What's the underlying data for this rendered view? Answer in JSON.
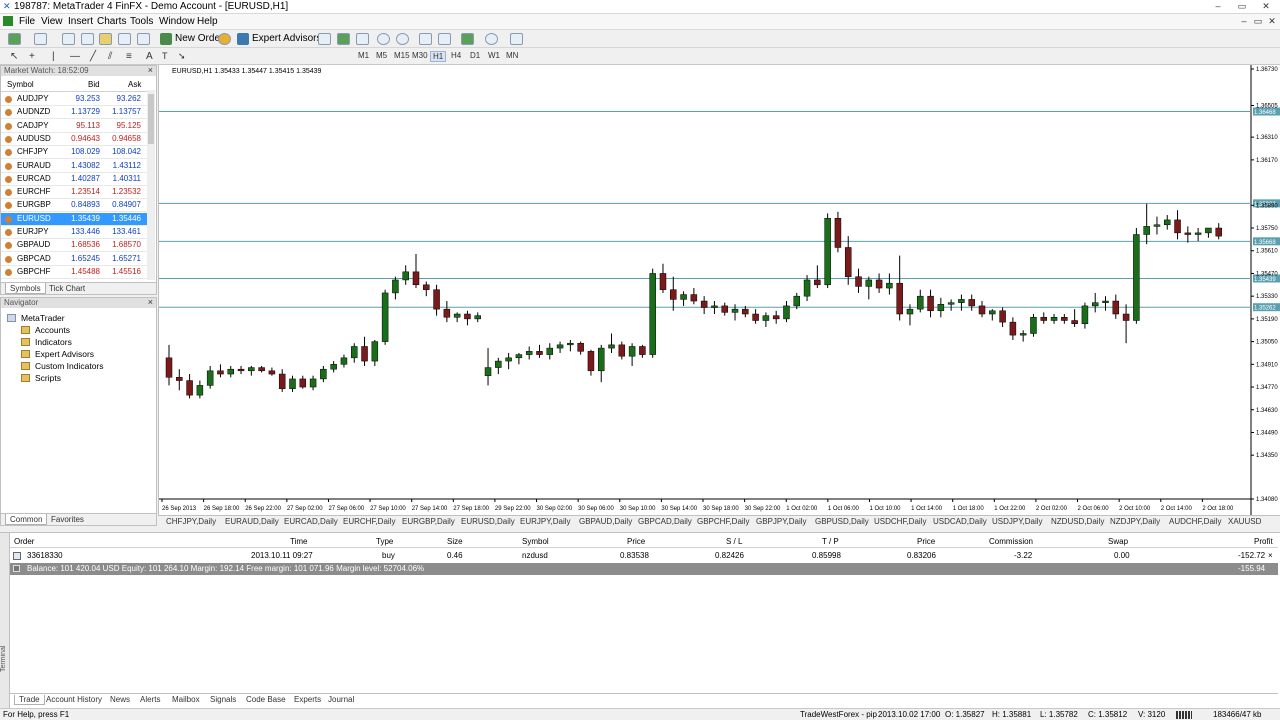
{
  "window": {
    "title": "198787: MetaTrader 4 FinFX - Demo Account - [EURUSD,H1]"
  },
  "menu": [
    "File",
    "View",
    "Insert",
    "Charts",
    "Tools",
    "Window",
    "Help"
  ],
  "toolbar": {
    "new_order": "New Order",
    "expert_advisors": "Expert Advisors",
    "timeframes": [
      "M1",
      "M5",
      "M15",
      "M30",
      "H1",
      "H4",
      "D1",
      "W1",
      "MN"
    ],
    "active_timeframe": "H1"
  },
  "market_watch": {
    "title": "Market Watch: 18:52:09",
    "headers": {
      "symbol": "Symbol",
      "bid": "Bid",
      "ask": "Ask"
    },
    "rows": [
      {
        "symbol": "AUDJPY",
        "bid": "93.253",
        "ask": "93.262",
        "dir": "up"
      },
      {
        "symbol": "AUDNZD",
        "bid": "1.13729",
        "ask": "1.13757",
        "dir": "up"
      },
      {
        "symbol": "CADJPY",
        "bid": "95.113",
        "ask": "95.125",
        "dir": "down"
      },
      {
        "symbol": "AUDUSD",
        "bid": "0.94643",
        "ask": "0.94658",
        "dir": "down"
      },
      {
        "symbol": "CHFJPY",
        "bid": "108.029",
        "ask": "108.042",
        "dir": "up"
      },
      {
        "symbol": "EURAUD",
        "bid": "1.43082",
        "ask": "1.43112",
        "dir": "up"
      },
      {
        "symbol": "EURCAD",
        "bid": "1.40287",
        "ask": "1.40311",
        "dir": "up"
      },
      {
        "symbol": "EURCHF",
        "bid": "1.23514",
        "ask": "1.23532",
        "dir": "down"
      },
      {
        "symbol": "EURGBP",
        "bid": "0.84893",
        "ask": "0.84907",
        "dir": "up"
      },
      {
        "symbol": "EURUSD",
        "bid": "1.35439",
        "ask": "1.35446",
        "dir": "sel"
      },
      {
        "symbol": "EURJPY",
        "bid": "133.446",
        "ask": "133.461",
        "dir": "up"
      },
      {
        "symbol": "GBPAUD",
        "bid": "1.68536",
        "ask": "1.68570",
        "dir": "down"
      },
      {
        "symbol": "GBPCAD",
        "bid": "1.65245",
        "ask": "1.65271",
        "dir": "up"
      },
      {
        "symbol": "GBPCHF",
        "bid": "1.45488",
        "ask": "1.45516",
        "dir": "down"
      }
    ],
    "tabs": [
      "Symbols",
      "Tick Chart"
    ]
  },
  "navigator": {
    "title": "Navigator",
    "root": "MetaTrader",
    "items": [
      "Accounts",
      "Indicators",
      "Expert Advisors",
      "Custom Indicators",
      "Scripts"
    ],
    "tabs": [
      "Common",
      "Favorites"
    ]
  },
  "chart": {
    "info": "EURUSD,H1  1.35433 1.35447 1.35415 1.35439",
    "price_labels": [
      "1.36730",
      "1.36505",
      "1.36310",
      "1.36170",
      "1.35890",
      "1.35750",
      "1.35610",
      "1.35470",
      "1.35330",
      "1.35190",
      "1.35050",
      "1.34910",
      "1.34770",
      "1.34630",
      "1.34490",
      "1.34350",
      "1.34080"
    ],
    "level_labels": [
      "1.36468",
      "1.35902",
      "1.35668",
      "1.35439",
      "1.35262"
    ],
    "time_labels": [
      "26 Sep 2013",
      "26 Sep 18:00",
      "26 Sep 22:00",
      "27 Sep 02:00",
      "27 Sep 06:00",
      "27 Sep 10:00",
      "27 Sep 14:00",
      "27 Sep 18:00",
      "29 Sep 22:00",
      "30 Sep 02:00",
      "30 Sep 06:00",
      "30 Sep 10:00",
      "30 Sep 14:00",
      "30 Sep 18:00",
      "30 Sep 22:00",
      "1 Oct 02:00",
      "1 Oct 06:00",
      "1 Oct 10:00",
      "1 Oct 14:00",
      "1 Oct 18:00",
      "1 Oct 22:00",
      "2 Oct 02:00",
      "2 Oct 06:00",
      "2 Oct 10:00",
      "2 Oct 14:00",
      "2 Oct 18:00"
    ],
    "tabs": [
      "CHFJPY,Daily",
      "EURAUD,Daily",
      "EURCAD,Daily",
      "EURCHF,Daily",
      "EURGBP,Daily",
      "EURUSD,Daily",
      "EURJPY,Daily",
      "GBPAUD,Daily",
      "GBPCAD,Daily",
      "GBPCHF,Daily",
      "GBPJPY,Daily",
      "GBPUSD,Daily",
      "USDCHF,Daily",
      "USDCAD,Daily",
      "USDJPY,Daily",
      "NZDUSD,Daily",
      "NZDJPY,Daily",
      "AUDCHF,Daily",
      "XAUUSD"
    ],
    "colors": {
      "bull": "#1a6e1a",
      "bear": "#7a1a1a",
      "level": "#5aa0b0"
    },
    "candles": [
      [
        1.3495,
        1.3503,
        1.3478,
        1.3483
      ],
      [
        1.3483,
        1.3488,
        1.3475,
        1.3481
      ],
      [
        1.3481,
        1.3485,
        1.347,
        1.3472
      ],
      [
        1.3472,
        1.3481,
        1.347,
        1.3478
      ],
      [
        1.3478,
        1.349,
        1.3476,
        1.3487
      ],
      [
        1.3487,
        1.3491,
        1.3483,
        1.3485
      ],
      [
        1.3485,
        1.349,
        1.3483,
        1.3488
      ],
      [
        1.3488,
        1.349,
        1.3485,
        1.3487
      ],
      [
        1.3487,
        1.349,
        1.3484,
        1.3489
      ],
      [
        1.3489,
        1.349,
        1.3486,
        1.3487
      ],
      [
        1.3487,
        1.3489,
        1.3484,
        1.3485
      ],
      [
        1.3485,
        1.3488,
        1.3474,
        1.3476
      ],
      [
        1.3476,
        1.3484,
        1.3474,
        1.3482
      ],
      [
        1.3482,
        1.3484,
        1.3476,
        1.3477
      ],
      [
        1.3477,
        1.3484,
        1.3475,
        1.3482
      ],
      [
        1.3482,
        1.349,
        1.348,
        1.3488
      ],
      [
        1.3488,
        1.3493,
        1.3486,
        1.3491
      ],
      [
        1.3491,
        1.3497,
        1.3489,
        1.3495
      ],
      [
        1.3495,
        1.3504,
        1.3492,
        1.3502
      ],
      [
        1.3502,
        1.3508,
        1.349,
        1.3493
      ],
      [
        1.3493,
        1.3506,
        1.349,
        1.3505
      ],
      [
        1.3505,
        1.3537,
        1.3503,
        1.3535
      ],
      [
        1.3535,
        1.3545,
        1.3531,
        1.3543
      ],
      [
        1.3543,
        1.3552,
        1.354,
        1.3548
      ],
      [
        1.3548,
        1.3559,
        1.3538,
        1.354
      ],
      [
        1.354,
        1.3542,
        1.3533,
        1.3537
      ],
      [
        1.3537,
        1.354,
        1.3521,
        1.3525
      ],
      [
        1.3525,
        1.353,
        1.3517,
        1.352
      ],
      [
        1.352,
        1.3523,
        1.3517,
        1.3522
      ],
      [
        1.3522,
        1.3524,
        1.3515,
        1.3519
      ],
      [
        1.3519,
        1.3523,
        1.3517,
        1.3521
      ],
      [
        1.3484,
        1.3501,
        1.3478,
        1.3489
      ],
      [
        1.3489,
        1.3495,
        1.3485,
        1.3493
      ],
      [
        1.3493,
        1.3498,
        1.3488,
        1.3495
      ],
      [
        1.3495,
        1.3498,
        1.3491,
        1.3497
      ],
      [
        1.3497,
        1.3502,
        1.3494,
        1.3499
      ],
      [
        1.3499,
        1.3503,
        1.3495,
        1.3497
      ],
      [
        1.3497,
        1.3504,
        1.3494,
        1.3501
      ],
      [
        1.3501,
        1.3505,
        1.3498,
        1.3503
      ],
      [
        1.3503,
        1.3506,
        1.3499,
        1.3504
      ],
      [
        1.3504,
        1.3505,
        1.3497,
        1.3499
      ],
      [
        1.3499,
        1.35,
        1.3484,
        1.3487
      ],
      [
        1.3487,
        1.3503,
        1.348,
        1.3501
      ],
      [
        1.3501,
        1.351,
        1.3498,
        1.3503
      ],
      [
        1.3503,
        1.3505,
        1.3494,
        1.3496
      ],
      [
        1.3496,
        1.3504,
        1.349,
        1.3502
      ],
      [
        1.3502,
        1.3503,
        1.3495,
        1.3497
      ],
      [
        1.3497,
        1.355,
        1.3495,
        1.3547
      ],
      [
        1.3547,
        1.3553,
        1.3535,
        1.3537
      ],
      [
        1.3537,
        1.3545,
        1.3524,
        1.3531
      ],
      [
        1.3531,
        1.3536,
        1.3527,
        1.3534
      ],
      [
        1.3534,
        1.3538,
        1.3528,
        1.353
      ],
      [
        1.353,
        1.3533,
        1.3522,
        1.3526
      ],
      [
        1.3526,
        1.353,
        1.3522,
        1.3527
      ],
      [
        1.3527,
        1.3529,
        1.3521,
        1.3523
      ],
      [
        1.3523,
        1.3528,
        1.3518,
        1.3525
      ],
      [
        1.3525,
        1.3527,
        1.352,
        1.3522
      ],
      [
        1.3522,
        1.3525,
        1.3516,
        1.3518
      ],
      [
        1.3518,
        1.3523,
        1.3514,
        1.3521
      ],
      [
        1.3521,
        1.3524,
        1.3516,
        1.3519
      ],
      [
        1.3519,
        1.353,
        1.3517,
        1.3527
      ],
      [
        1.3527,
        1.3535,
        1.3525,
        1.3533
      ],
      [
        1.3533,
        1.3546,
        1.353,
        1.3543
      ],
      [
        1.3543,
        1.3552,
        1.3538,
        1.354
      ],
      [
        1.354,
        1.3584,
        1.3538,
        1.3581
      ],
      [
        1.3581,
        1.3585,
        1.356,
        1.3563
      ],
      [
        1.3563,
        1.357,
        1.354,
        1.3545
      ],
      [
        1.3545,
        1.355,
        1.3535,
        1.3539
      ],
      [
        1.3539,
        1.3545,
        1.3531,
        1.3543
      ],
      [
        1.3543,
        1.3547,
        1.3535,
        1.3538
      ],
      [
        1.3538,
        1.3547,
        1.3534,
        1.3541
      ],
      [
        1.3541,
        1.3558,
        1.3518,
        1.3522
      ],
      [
        1.3522,
        1.3528,
        1.3515,
        1.3525
      ],
      [
        1.3525,
        1.3537,
        1.3523,
        1.3533
      ],
      [
        1.3533,
        1.3537,
        1.352,
        1.3524
      ],
      [
        1.3524,
        1.3532,
        1.352,
        1.3528
      ],
      [
        1.3528,
        1.3531,
        1.3524,
        1.3529
      ],
      [
        1.3529,
        1.3534,
        1.3524,
        1.3531
      ],
      [
        1.3531,
        1.3534,
        1.3524,
        1.3527
      ],
      [
        1.3527,
        1.353,
        1.352,
        1.3522
      ],
      [
        1.3522,
        1.3525,
        1.3518,
        1.3524
      ],
      [
        1.3524,
        1.3526,
        1.3514,
        1.3517
      ],
      [
        1.3517,
        1.352,
        1.3506,
        1.3509
      ],
      [
        1.3509,
        1.3512,
        1.3505,
        1.351
      ],
      [
        1.351,
        1.3522,
        1.3508,
        1.352
      ],
      [
        1.352,
        1.3523,
        1.3516,
        1.3518
      ],
      [
        1.3518,
        1.3522,
        1.3516,
        1.352
      ],
      [
        1.352,
        1.3522,
        1.3516,
        1.3518
      ],
      [
        1.3518,
        1.3525,
        1.3514,
        1.3516
      ],
      [
        1.3516,
        1.3529,
        1.3513,
        1.3527
      ],
      [
        1.3527,
        1.3535,
        1.3523,
        1.3529
      ],
      [
        1.3529,
        1.3533,
        1.3524,
        1.353
      ],
      [
        1.353,
        1.3534,
        1.3519,
        1.3522
      ],
      [
        1.3522,
        1.3528,
        1.3504,
        1.3518
      ],
      [
        1.3518,
        1.3575,
        1.3516,
        1.3571
      ],
      [
        1.3571,
        1.359,
        1.3565,
        1.3576
      ],
      [
        1.3576,
        1.3582,
        1.3571,
        1.3577
      ],
      [
        1.3577,
        1.3583,
        1.3574,
        1.358
      ],
      [
        1.358,
        1.3586,
        1.3568,
        1.3572
      ],
      [
        1.3572,
        1.3576,
        1.3566,
        1.3571
      ],
      [
        1.3571,
        1.3575,
        1.3567,
        1.3572
      ],
      [
        1.3572,
        1.3575,
        1.3569,
        1.3575
      ],
      [
        1.3575,
        1.3578,
        1.3568,
        1.357
      ]
    ],
    "levels": [
      1.36468,
      1.35902,
      1.35668,
      1.35439,
      1.35262
    ],
    "ylim": [
      1.3408,
      1.3673
    ]
  },
  "terminal": {
    "headers": {
      "order": "Order",
      "time": "Time",
      "type": "Type",
      "size": "Size",
      "symbol": "Symbol",
      "price": "Price",
      "sl": "S / L",
      "tp": "T / P",
      "price2": "Price",
      "commission": "Commission",
      "swap": "Swap",
      "profit": "Profit"
    },
    "order": {
      "order": "33618330",
      "time": "2013.10.11 09:27",
      "type": "buy",
      "size": "0.46",
      "symbol": "nzdusd",
      "price": "0.83538",
      "sl": "0.82426",
      "tp": "0.85998",
      "price2": "0.83206",
      "commission": "-3.22",
      "swap": "0.00",
      "profit": "-152.72"
    },
    "balance": "Balance: 101 420.04 USD  Equity: 101 264.10  Margin: 192.14  Free margin: 101 071.96  Margin level: 52704.06%",
    "balance_profit": "-155.94",
    "tabs": [
      "Trade",
      "Account History",
      "News",
      "Alerts",
      "Mailbox",
      "Signals",
      "Code Base",
      "Experts",
      "Journal"
    ],
    "side_label": "Terminal"
  },
  "status": {
    "help": "For Help, press F1",
    "profile": "TradeWestForex - pip",
    "time": "2013.10.02 17:00",
    "open": "O: 1.35827",
    "high": "H: 1.35881",
    "low": "L: 1.35782",
    "close": "C: 1.35812",
    "volume": "V: 3120",
    "traffic": "183466/47 kb"
  }
}
